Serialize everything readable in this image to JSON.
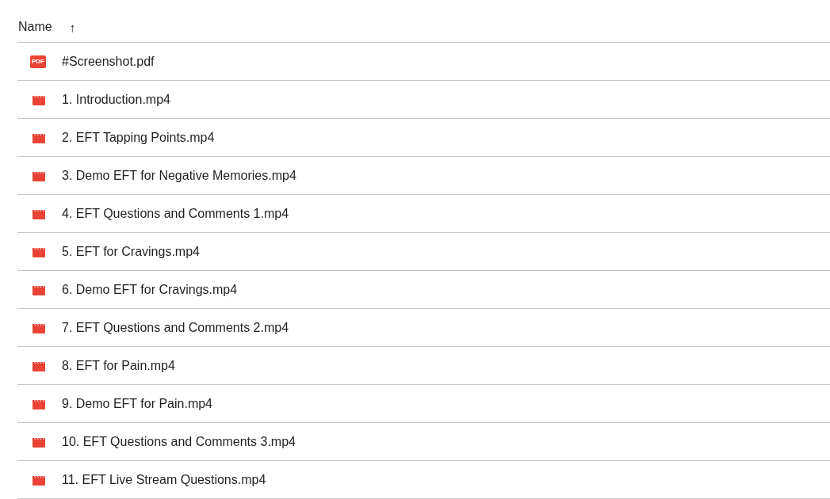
{
  "table": {
    "columns": [
      {
        "label": "Name",
        "sort_indicator": "↑"
      }
    ],
    "rows": [
      {
        "kind": "pdf",
        "icon_label": "PDF",
        "name": "#Screenshot.pdf"
      },
      {
        "kind": "video",
        "name": "1. Introduction.mp4"
      },
      {
        "kind": "video",
        "name": "2. EFT Tapping Points.mp4"
      },
      {
        "kind": "video",
        "name": "3. Demo EFT for Negative Memories.mp4"
      },
      {
        "kind": "video",
        "name": "4. EFT Questions and Comments 1.mp4"
      },
      {
        "kind": "video",
        "name": "5. EFT for Cravings.mp4"
      },
      {
        "kind": "video",
        "name": "6. Demo EFT for Cravings.mp4"
      },
      {
        "kind": "video",
        "name": "7. EFT Questions and Comments 2.mp4"
      },
      {
        "kind": "video",
        "name": "8. EFT for Pain.mp4"
      },
      {
        "kind": "video",
        "name": "9. Demo EFT for Pain.mp4"
      },
      {
        "kind": "video",
        "name": "10. EFT Questions and Comments 3.mp4"
      },
      {
        "kind": "video",
        "name": "11. EFT Live Stream Questions.mp4"
      }
    ]
  }
}
